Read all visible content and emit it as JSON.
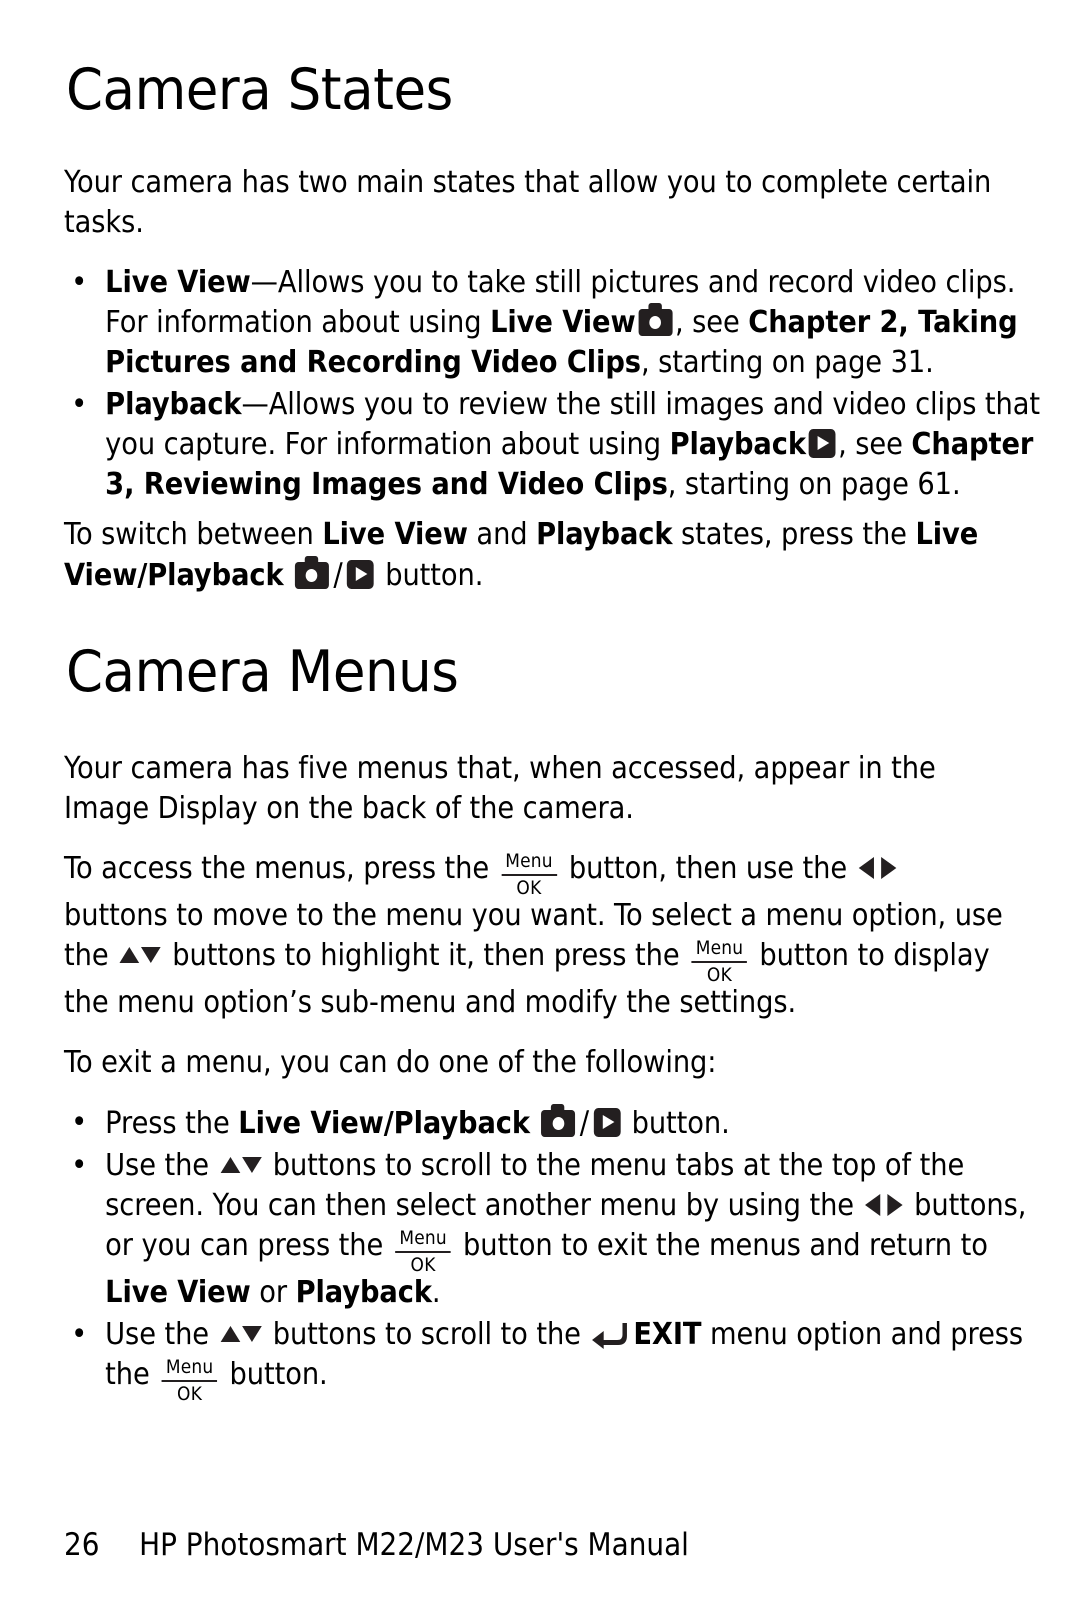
{
  "document": {
    "title": "HP Photosmart M22/M23 User's Manual",
    "page_number": "26"
  },
  "sections": [
    {
      "heading": "Camera States",
      "intro": "Your camera has two main states that allow you to complete certain tasks.",
      "bullets": [
        {
          "lead": "Live View",
          "dash": "—",
          "text_1": "Allows you to take still pictures and record video clips. For information about using ",
          "bold_1": "Live View",
          "icon_1": "camera-icon",
          "text_2": ", see ",
          "bold_2": "Chapter 2, Taking Pictures and Recording Video Clips",
          "text_3": ", starting on page 31."
        },
        {
          "lead": "Playback",
          "dash": "—",
          "text_1": "Allows you to review the still images and video clips that you capture. For information about using ",
          "bold_1": "Playback",
          "icon_1": "playback-icon",
          "text_2": ", see ",
          "bold_2": "Chapter 3, Reviewing Images and Video Clips",
          "text_3": ", starting on page 61."
        }
      ],
      "closing": {
        "t1": "To switch between ",
        "b1": "Live View",
        "t2": " and ",
        "b2": "Playback",
        "t3": " states, press the ",
        "b3": "Live View/Playback",
        "icon_camera": "camera-icon",
        "slash": "/",
        "icon_playback": "playback-icon",
        "t4": " button."
      }
    },
    {
      "heading": "Camera Menus",
      "paragraph_1": "Your camera has five menus that, when accessed, appear in the Image Display on the back of the camera.",
      "paragraph_2": {
        "t1": "To access the menus, press the ",
        "icon_menu_ok": "menu-ok-icon",
        "t2": " button, then use the ",
        "icon_left_right": "left-right-arrows-icon",
        "t3": " buttons to move to the menu you want. To select a menu option, use the ",
        "icon_up_down": "up-down-arrows-icon",
        "t4": " buttons to highlight it, then press the ",
        "icon_menu_ok_2": "menu-ok-icon",
        "t5": " button to display the menu option’s sub-menu and modify the settings."
      },
      "paragraph_3": "To exit a menu, you can do one of the following:",
      "exit_bullets": [
        {
          "t1": "Press the ",
          "b1": "Live View/Playback",
          "icon_camera": "camera-icon",
          "slash": "/",
          "icon_playback": "playback-icon",
          "t2": " button."
        },
        {
          "t1": "Use the ",
          "icon_up_down": "up-down-arrows-icon",
          "t2": " buttons to scroll to the menu tabs at the top of the screen. You can then select another menu by using the ",
          "icon_left_right": "left-right-arrows-icon",
          "t3": " buttons, or you can press the ",
          "icon_menu_ok": "menu-ok-icon",
          "t4": " button to exit the menus and return to ",
          "b1": "Live View",
          "t5": " or ",
          "b2": "Playback",
          "t6": "."
        },
        {
          "t1": "Use the ",
          "icon_up_down": "up-down-arrows-icon",
          "t2": " buttons to scroll to the ",
          "icon_back": "back-arrow-icon",
          "b1": "EXIT",
          "t3": " menu option and press the ",
          "icon_menu_ok": "menu-ok-icon",
          "t4": " button."
        }
      ]
    }
  ],
  "icon_labels": {
    "menu_ok_top": "Menu",
    "menu_ok_bottom": "OK"
  },
  "bullet_char": "•",
  "colors": {
    "text": "#000000",
    "icon_fill": "#231f20",
    "page_background": "#ffffff"
  }
}
